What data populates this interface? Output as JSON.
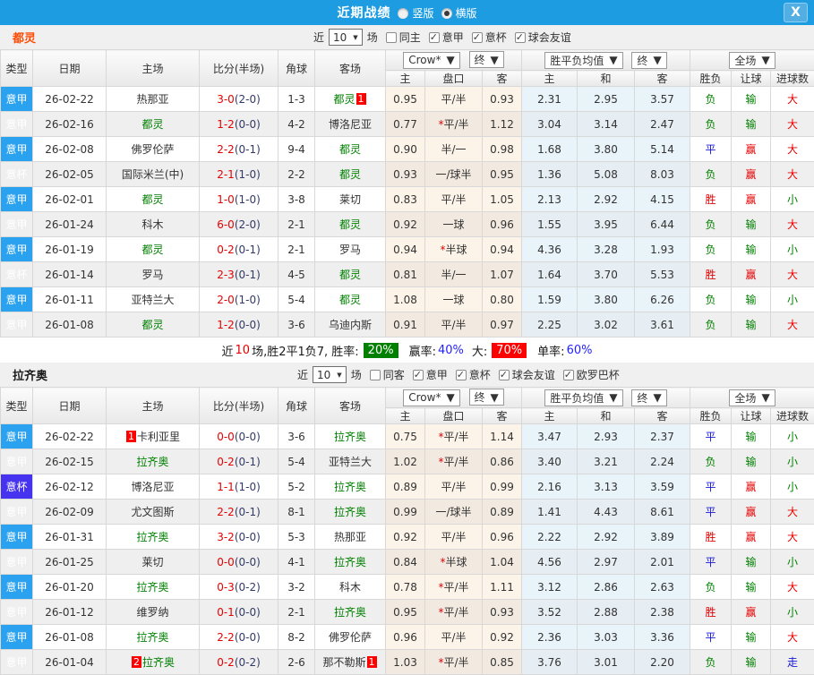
{
  "titlebar": {
    "title": "近期战绩",
    "view_options": [
      {
        "label": "竖版",
        "selected": false
      },
      {
        "label": "横版",
        "selected": true
      }
    ],
    "close_label": "X"
  },
  "colors": {
    "titlebar_bg": "#1e9ce2",
    "league_serie_a_bg": "#2aa2f0",
    "league_cup_bg": "#4633f0",
    "win_text": "#e60000",
    "draw_text": "#1616d6",
    "loss_text": "#008000",
    "focus_team_text": "#008000",
    "torino_label_text": "#ff4a00",
    "score_fulltime_text": "#e60000",
    "summary_winrate_bg": "#008000",
    "summary_bigrate_bg": "#ff0000",
    "odds_cols_bg": "#fdf4e9",
    "avg_cols_bg": "#e9f3fa"
  },
  "table_header": {
    "cols": [
      "类型",
      "日期",
      "主场",
      "比分(半场)",
      "角球",
      "客场"
    ],
    "odds_select": "Crow*",
    "odds_final_select": "终",
    "avg_select": "胜平负均值",
    "avg_final_select": "终",
    "scope_select": "全场",
    "sub": [
      "主",
      "盘口",
      "客",
      "主",
      "和",
      "客",
      "胜负",
      "让球",
      "进球数"
    ]
  },
  "sections": [
    {
      "team": "都灵",
      "team_color": "#ff4a00",
      "filter": {
        "near": "近",
        "count": "10",
        "games": "场",
        "boxes": [
          {
            "label": "同主",
            "checked": false
          },
          {
            "label": "意甲",
            "checked": true
          },
          {
            "label": "意杯",
            "checked": true
          },
          {
            "label": "球会友谊",
            "checked": true
          }
        ]
      },
      "rows": [
        {
          "lg": "意甲",
          "cup": false,
          "date": "26-02-22",
          "home": {
            "n": "热那亚",
            "c": "dark"
          },
          "ft": "3-0",
          "ht": "(2-0)",
          "cor": "1-3",
          "away": {
            "n": "都灵",
            "c": "green",
            "b": "1"
          },
          "o1": "0.95",
          "star": false,
          "hcap": "平/半",
          "o2": "0.93",
          "a1": "2.31",
          "a2": "2.95",
          "a3": "3.57",
          "r": [
            "负",
            "green"
          ],
          "h": [
            "输",
            "green"
          ],
          "g": [
            "大",
            "red"
          ]
        },
        {
          "lg": "意甲",
          "cup": false,
          "date": "26-02-16",
          "home": {
            "n": "都灵",
            "c": "green"
          },
          "ft": "1-2",
          "ht": "(0-0)",
          "cor": "4-2",
          "away": {
            "n": "博洛尼亚",
            "c": "dark"
          },
          "o1": "0.77",
          "star": true,
          "hcap": "平/半",
          "o2": "1.12",
          "a1": "3.04",
          "a2": "3.14",
          "a3": "2.47",
          "r": [
            "负",
            "green"
          ],
          "h": [
            "输",
            "green"
          ],
          "g": [
            "大",
            "red"
          ]
        },
        {
          "lg": "意甲",
          "cup": false,
          "date": "26-02-08",
          "home": {
            "n": "佛罗伦萨",
            "c": "dark"
          },
          "ft": "2-2",
          "ht": "(0-1)",
          "cor": "9-4",
          "away": {
            "n": "都灵",
            "c": "green"
          },
          "o1": "0.90",
          "star": false,
          "hcap": "半/一",
          "o2": "0.98",
          "a1": "1.68",
          "a2": "3.80",
          "a3": "5.14",
          "r": [
            "平",
            "blue"
          ],
          "h": [
            "赢",
            "red"
          ],
          "g": [
            "大",
            "red"
          ]
        },
        {
          "lg": "意杯",
          "cup": true,
          "date": "26-02-05",
          "home": {
            "n": "国际米兰(中)",
            "c": "dark"
          },
          "ft": "2-1",
          "ht": "(1-0)",
          "cor": "2-2",
          "away": {
            "n": "都灵",
            "c": "green"
          },
          "o1": "0.93",
          "star": false,
          "hcap": "一/球半",
          "o2": "0.95",
          "a1": "1.36",
          "a2": "5.08",
          "a3": "8.03",
          "r": [
            "负",
            "green"
          ],
          "h": [
            "赢",
            "red"
          ],
          "g": [
            "大",
            "red"
          ]
        },
        {
          "lg": "意甲",
          "cup": false,
          "date": "26-02-01",
          "home": {
            "n": "都灵",
            "c": "green"
          },
          "ft": "1-0",
          "ht": "(1-0)",
          "cor": "3-8",
          "away": {
            "n": "莱切",
            "c": "dark"
          },
          "o1": "0.83",
          "star": false,
          "hcap": "平/半",
          "o2": "1.05",
          "a1": "2.13",
          "a2": "2.92",
          "a3": "4.15",
          "r": [
            "胜",
            "red"
          ],
          "h": [
            "赢",
            "red"
          ],
          "g": [
            "小",
            "green"
          ]
        },
        {
          "lg": "意甲",
          "cup": false,
          "date": "26-01-24",
          "home": {
            "n": "科木",
            "c": "dark"
          },
          "ft": "6-0",
          "ht": "(2-0)",
          "cor": "2-1",
          "away": {
            "n": "都灵",
            "c": "green"
          },
          "o1": "0.92",
          "star": false,
          "hcap": "一球",
          "o2": "0.96",
          "a1": "1.55",
          "a2": "3.95",
          "a3": "6.44",
          "r": [
            "负",
            "green"
          ],
          "h": [
            "输",
            "green"
          ],
          "g": [
            "大",
            "red"
          ]
        },
        {
          "lg": "意甲",
          "cup": false,
          "date": "26-01-19",
          "home": {
            "n": "都灵",
            "c": "green"
          },
          "ft": "0-2",
          "ht": "(0-1)",
          "cor": "2-1",
          "away": {
            "n": "罗马",
            "c": "dark"
          },
          "o1": "0.94",
          "star": true,
          "hcap": "半球",
          "o2": "0.94",
          "a1": "4.36",
          "a2": "3.28",
          "a3": "1.93",
          "r": [
            "负",
            "green"
          ],
          "h": [
            "输",
            "green"
          ],
          "g": [
            "小",
            "green"
          ]
        },
        {
          "lg": "意杯",
          "cup": true,
          "date": "26-01-14",
          "home": {
            "n": "罗马",
            "c": "dark"
          },
          "ft": "2-3",
          "ht": "(0-1)",
          "cor": "4-5",
          "away": {
            "n": "都灵",
            "c": "green"
          },
          "o1": "0.81",
          "star": false,
          "hcap": "半/一",
          "o2": "1.07",
          "a1": "1.64",
          "a2": "3.70",
          "a3": "5.53",
          "r": [
            "胜",
            "red"
          ],
          "h": [
            "赢",
            "red"
          ],
          "g": [
            "大",
            "red"
          ]
        },
        {
          "lg": "意甲",
          "cup": false,
          "date": "26-01-11",
          "home": {
            "n": "亚特兰大",
            "c": "dark"
          },
          "ft": "2-0",
          "ht": "(1-0)",
          "cor": "5-4",
          "away": {
            "n": "都灵",
            "c": "green"
          },
          "o1": "1.08",
          "star": false,
          "hcap": "一球",
          "o2": "0.80",
          "a1": "1.59",
          "a2": "3.80",
          "a3": "6.26",
          "r": [
            "负",
            "green"
          ],
          "h": [
            "输",
            "green"
          ],
          "g": [
            "小",
            "green"
          ]
        },
        {
          "lg": "意甲",
          "cup": false,
          "date": "26-01-08",
          "home": {
            "n": "都灵",
            "c": "green"
          },
          "ft": "1-2",
          "ht": "(0-0)",
          "cor": "3-6",
          "away": {
            "n": "乌迪内斯",
            "c": "dark"
          },
          "o1": "0.91",
          "star": false,
          "hcap": "平/半",
          "o2": "0.97",
          "a1": "2.25",
          "a2": "3.02",
          "a3": "3.61",
          "r": [
            "负",
            "green"
          ],
          "h": [
            "输",
            "green"
          ],
          "g": [
            "大",
            "red"
          ]
        }
      ],
      "summary": {
        "seg_near": "近",
        "seg_count": "10",
        "seg_record": "场,胜2平1负7, 胜率:",
        "win_rate": "20%",
        "label_win": "赢率:",
        "win_value": "40%",
        "label_big": "大:",
        "big_rate": "70%",
        "label_single": "单率:",
        "single_value": "60%"
      }
    },
    {
      "team": "拉齐奥",
      "team_color": "#1a1a1a",
      "filter": {
        "near": "近",
        "count": "10",
        "games": "场",
        "boxes": [
          {
            "label": "同客",
            "checked": false
          },
          {
            "label": "意甲",
            "checked": true
          },
          {
            "label": "意杯",
            "checked": true
          },
          {
            "label": "球会友谊",
            "checked": true
          },
          {
            "label": "欧罗巴杯",
            "checked": true
          }
        ]
      },
      "rows": [
        {
          "lg": "意甲",
          "cup": false,
          "date": "26-02-22",
          "home": {
            "n": "卡利亚里",
            "c": "dark",
            "b": "1"
          },
          "ft": "0-0",
          "ht": "(0-0)",
          "cor": "3-6",
          "away": {
            "n": "拉齐奥",
            "c": "green"
          },
          "o1": "0.75",
          "star": true,
          "hcap": "平/半",
          "o2": "1.14",
          "a1": "3.47",
          "a2": "2.93",
          "a3": "2.37",
          "r": [
            "平",
            "blue"
          ],
          "h": [
            "输",
            "green"
          ],
          "g": [
            "小",
            "green"
          ]
        },
        {
          "lg": "意甲",
          "cup": false,
          "date": "26-02-15",
          "home": {
            "n": "拉齐奥",
            "c": "green"
          },
          "ft": "0-2",
          "ht": "(0-1)",
          "cor": "5-4",
          "away": {
            "n": "亚特兰大",
            "c": "dark"
          },
          "o1": "1.02",
          "star": true,
          "hcap": "平/半",
          "o2": "0.86",
          "a1": "3.40",
          "a2": "3.21",
          "a3": "2.24",
          "r": [
            "负",
            "green"
          ],
          "h": [
            "输",
            "green"
          ],
          "g": [
            "小",
            "green"
          ]
        },
        {
          "lg": "意杯",
          "cup": true,
          "date": "26-02-12",
          "home": {
            "n": "博洛尼亚",
            "c": "dark"
          },
          "ft": "1-1",
          "ht": "(1-0)",
          "cor": "5-2",
          "away": {
            "n": "拉齐奥",
            "c": "green"
          },
          "o1": "0.89",
          "star": false,
          "hcap": "平/半",
          "o2": "0.99",
          "a1": "2.16",
          "a2": "3.13",
          "a3": "3.59",
          "r": [
            "平",
            "blue"
          ],
          "h": [
            "赢",
            "red"
          ],
          "g": [
            "小",
            "green"
          ]
        },
        {
          "lg": "意甲",
          "cup": false,
          "date": "26-02-09",
          "home": {
            "n": "尤文图斯",
            "c": "dark"
          },
          "ft": "2-2",
          "ht": "(0-1)",
          "cor": "8-1",
          "away": {
            "n": "拉齐奥",
            "c": "green"
          },
          "o1": "0.99",
          "star": false,
          "hcap": "一/球半",
          "o2": "0.89",
          "a1": "1.41",
          "a2": "4.43",
          "a3": "8.61",
          "r": [
            "平",
            "blue"
          ],
          "h": [
            "赢",
            "red"
          ],
          "g": [
            "大",
            "red"
          ]
        },
        {
          "lg": "意甲",
          "cup": false,
          "date": "26-01-31",
          "home": {
            "n": "拉齐奥",
            "c": "green"
          },
          "ft": "3-2",
          "ht": "(0-0)",
          "cor": "5-3",
          "away": {
            "n": "热那亚",
            "c": "dark"
          },
          "o1": "0.92",
          "star": false,
          "hcap": "平/半",
          "o2": "0.96",
          "a1": "2.22",
          "a2": "2.92",
          "a3": "3.89",
          "r": [
            "胜",
            "red"
          ],
          "h": [
            "赢",
            "red"
          ],
          "g": [
            "大",
            "red"
          ]
        },
        {
          "lg": "意甲",
          "cup": false,
          "date": "26-01-25",
          "home": {
            "n": "莱切",
            "c": "dark"
          },
          "ft": "0-0",
          "ht": "(0-0)",
          "cor": "4-1",
          "away": {
            "n": "拉齐奥",
            "c": "green"
          },
          "o1": "0.84",
          "star": true,
          "hcap": "半球",
          "o2": "1.04",
          "a1": "4.56",
          "a2": "2.97",
          "a3": "2.01",
          "r": [
            "平",
            "blue"
          ],
          "h": [
            "输",
            "green"
          ],
          "g": [
            "小",
            "green"
          ]
        },
        {
          "lg": "意甲",
          "cup": false,
          "date": "26-01-20",
          "home": {
            "n": "拉齐奥",
            "c": "green"
          },
          "ft": "0-3",
          "ht": "(0-2)",
          "cor": "3-2",
          "away": {
            "n": "科木",
            "c": "dark"
          },
          "o1": "0.78",
          "star": true,
          "hcap": "平/半",
          "o2": "1.11",
          "a1": "3.12",
          "a2": "2.86",
          "a3": "2.63",
          "r": [
            "负",
            "green"
          ],
          "h": [
            "输",
            "green"
          ],
          "g": [
            "大",
            "red"
          ]
        },
        {
          "lg": "意甲",
          "cup": false,
          "date": "26-01-12",
          "home": {
            "n": "维罗纳",
            "c": "dark"
          },
          "ft": "0-1",
          "ht": "(0-0)",
          "cor": "2-1",
          "away": {
            "n": "拉齐奥",
            "c": "green"
          },
          "o1": "0.95",
          "star": true,
          "hcap": "平/半",
          "o2": "0.93",
          "a1": "3.52",
          "a2": "2.88",
          "a3": "2.38",
          "r": [
            "胜",
            "red"
          ],
          "h": [
            "赢",
            "red"
          ],
          "g": [
            "小",
            "green"
          ]
        },
        {
          "lg": "意甲",
          "cup": false,
          "date": "26-01-08",
          "home": {
            "n": "拉齐奥",
            "c": "green"
          },
          "ft": "2-2",
          "ht": "(0-0)",
          "cor": "8-2",
          "away": {
            "n": "佛罗伦萨",
            "c": "dark"
          },
          "o1": "0.96",
          "star": false,
          "hcap": "平/半",
          "o2": "0.92",
          "a1": "2.36",
          "a2": "3.03",
          "a3": "3.36",
          "r": [
            "平",
            "blue"
          ],
          "h": [
            "输",
            "green"
          ],
          "g": [
            "大",
            "red"
          ]
        },
        {
          "lg": "意甲",
          "cup": false,
          "date": "26-01-04",
          "home": {
            "n": "拉齐奥",
            "c": "green",
            "b": "2"
          },
          "ft": "0-2",
          "ht": "(0-2)",
          "cor": "2-6",
          "away": {
            "n": "那不勒斯",
            "c": "dark",
            "b": "1"
          },
          "o1": "1.03",
          "star": true,
          "hcap": "平/半",
          "o2": "0.85",
          "a1": "3.76",
          "a2": "3.01",
          "a3": "2.20",
          "r": [
            "负",
            "green"
          ],
          "h": [
            "输",
            "green"
          ],
          "g": [
            "走",
            "blue"
          ]
        }
      ]
    }
  ]
}
